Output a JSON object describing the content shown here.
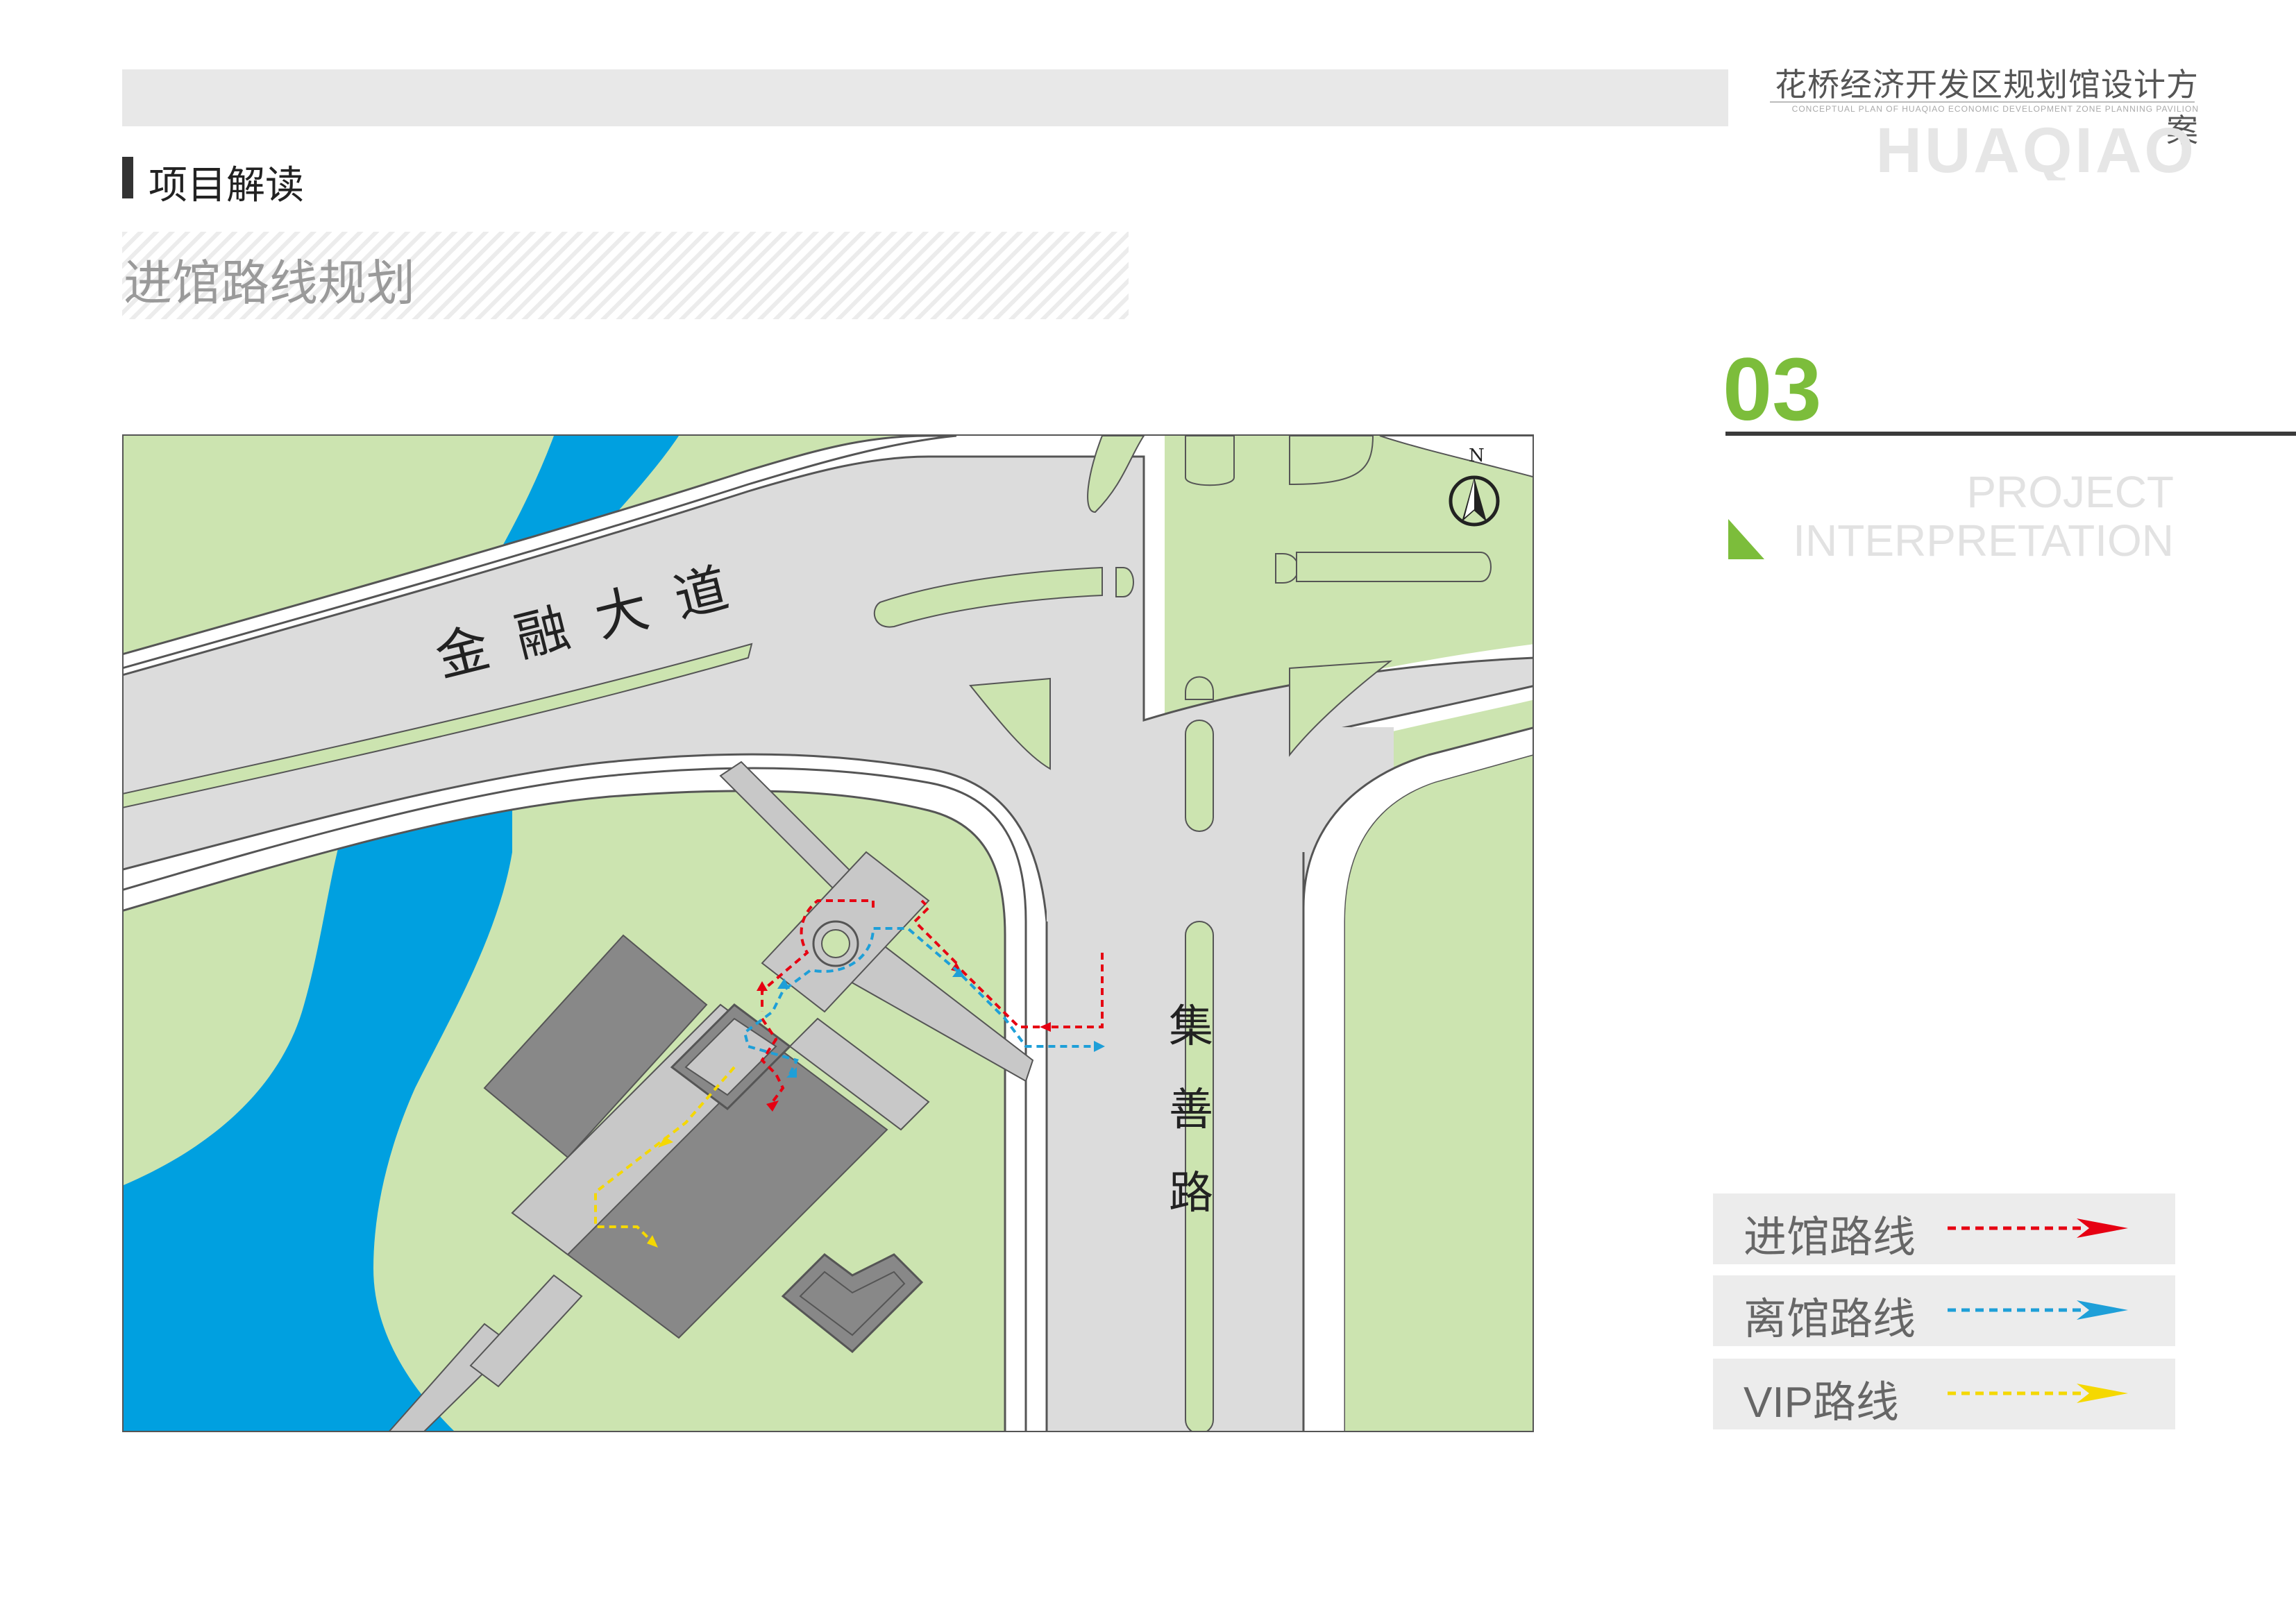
{
  "header": {
    "brand_cn": "花桥经济开发区规划馆设计方案",
    "brand_en": "CONCEPTUAL PLAN OF HUAQIAO ECONOMIC DEVELOPMENT ZONE PLANNING PAVILION",
    "brand_logo": "HUAQIAO"
  },
  "section": {
    "title": "项目解读",
    "subtitle": "进馆路线规划"
  },
  "chapter": {
    "number": "03",
    "en_line1": "PROJECT",
    "en_line2": "INTERPRETATION",
    "accent_color": "#7cbd3b"
  },
  "map": {
    "road_main": "金融大道",
    "road_side_chars": [
      "集",
      "善",
      "路"
    ],
    "north_label": "N",
    "colors": {
      "grass": "#cce4b0",
      "water": "#00a0e0",
      "road": "#dcdcdc",
      "building_dark": "#888888",
      "building_light": "#c8c8c8"
    }
  },
  "legend": [
    {
      "label": "进馆路线",
      "color": "#e60012"
    },
    {
      "label": "离馆路线",
      "color": "#1e9fd8"
    },
    {
      "label": "VIP路线",
      "color": "#f5d800"
    }
  ]
}
